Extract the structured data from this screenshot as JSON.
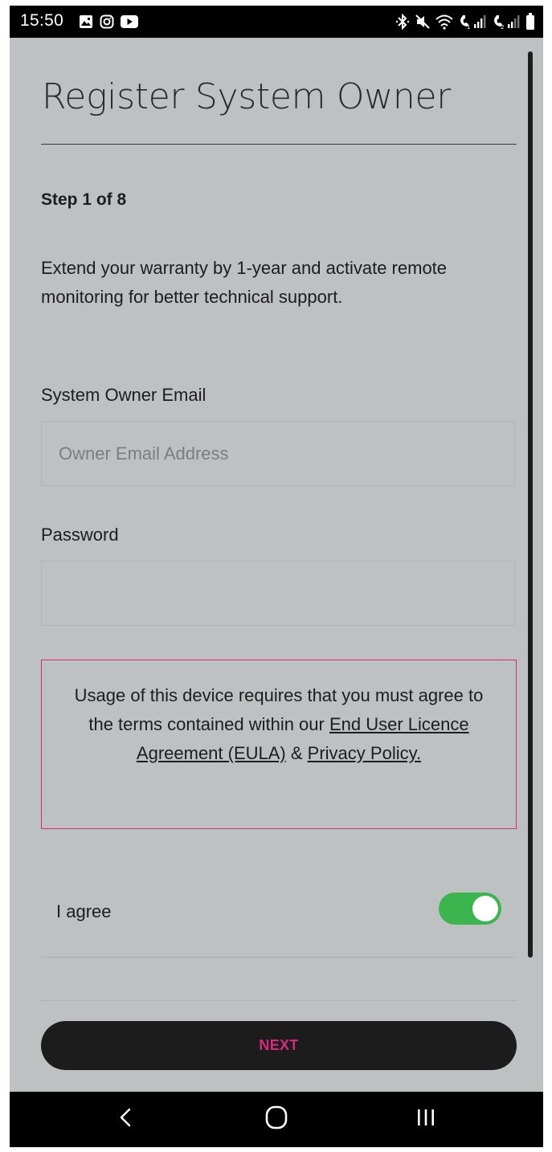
{
  "status_bar": {
    "time": "15:50",
    "left_icons": [
      "gallery-icon",
      "instagram-icon",
      "youtube-icon"
    ],
    "right_icons": [
      "bluetooth-icon",
      "mute-icon",
      "wifi-icon",
      "volte1-signal-icon",
      "volte2-signal-icon",
      "battery-icon"
    ]
  },
  "form": {
    "title": "Register System Owner",
    "step": "Step 1 of 8",
    "intro": "Extend your warranty by 1-year and activate remote monitoring for better technical support.",
    "email": {
      "label": "System Owner Email",
      "placeholder": "Owner Email Address",
      "value": ""
    },
    "password": {
      "label": "Password",
      "placeholder": "",
      "value": ""
    }
  },
  "eula": {
    "text_before": "Usage of this device requires that you must agree to the terms contained within our ",
    "eula_link": "End User Licence Agreement (EULA)",
    "separator": " & ",
    "privacy_link": "Privacy Policy.",
    "border_color": "#d92b78"
  },
  "agree": {
    "label": "I agree",
    "checked": true,
    "toggle_color": "#3bb54e"
  },
  "next_button": {
    "label": "NEXT",
    "text_color": "#d62a7a"
  },
  "nav_bar": {
    "buttons": [
      "back-icon",
      "home-icon",
      "recents-icon"
    ]
  },
  "colors": {
    "background": "#bec1c1",
    "text": "#1d1d1d",
    "accent": "#d62a7a"
  }
}
